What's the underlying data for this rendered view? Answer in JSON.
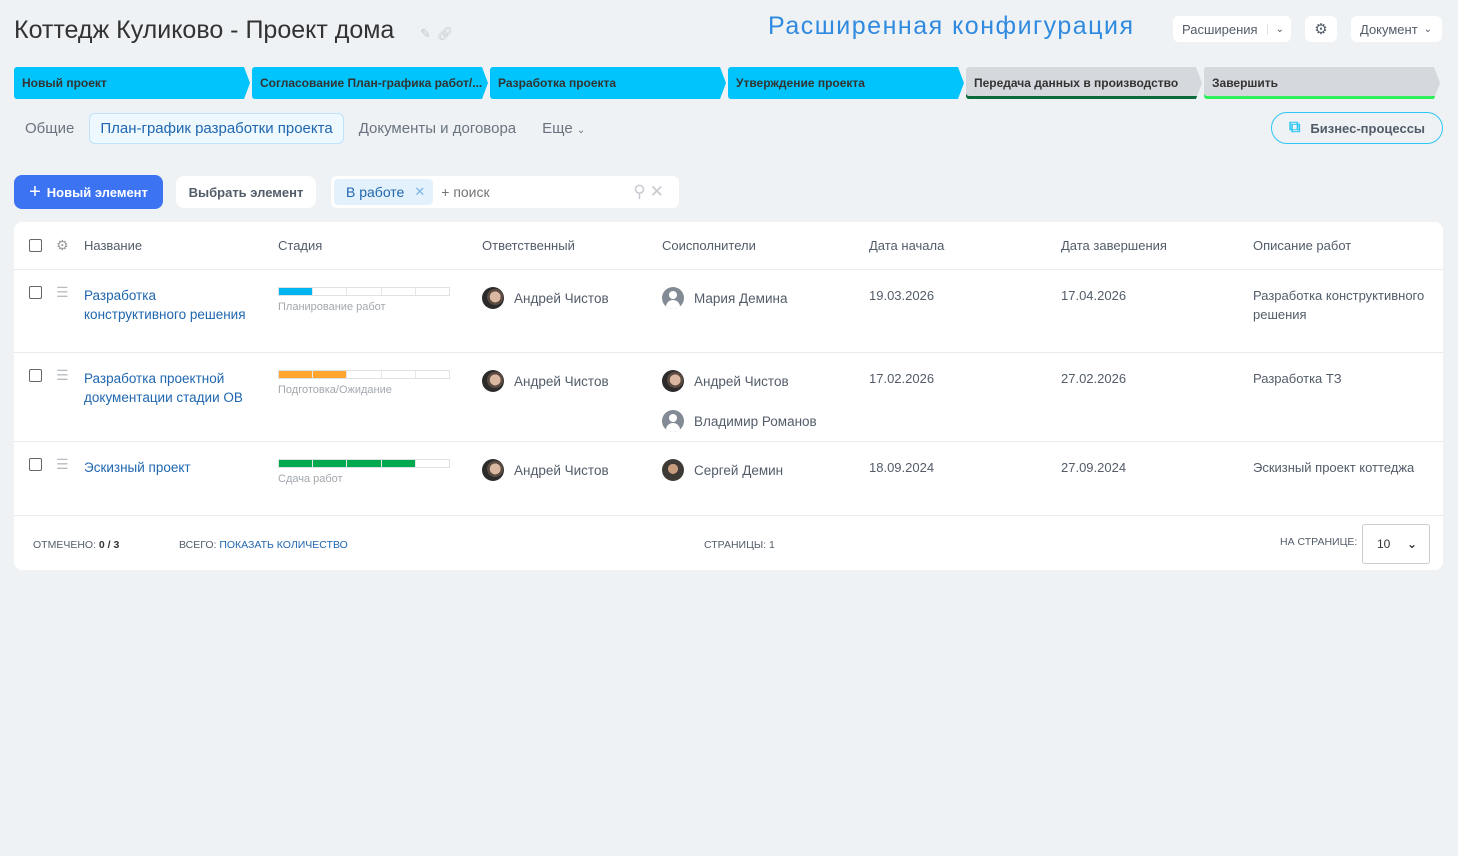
{
  "header": {
    "title": "Коттедж Куликово - Проект дома",
    "config_title": "Расширенная конфигурация",
    "extensions_label": "Расширения",
    "document_label": "Документ"
  },
  "stages": [
    {
      "label": "Новый проект",
      "state": "done"
    },
    {
      "label": "Согласование План-графика работ/...",
      "state": "done"
    },
    {
      "label": "Разработка проекта",
      "state": "done"
    },
    {
      "label": "Утверждение проекта",
      "state": "done"
    },
    {
      "label": "Передача данных в производство",
      "state": "todo",
      "underline": "#0b6b3a"
    },
    {
      "label": "Завершить",
      "state": "todo",
      "underline": "#2ef05a"
    }
  ],
  "tabs": [
    {
      "label": "Общие"
    },
    {
      "label": "План-график разработки проекта"
    },
    {
      "label": "Документы и договора"
    },
    {
      "label": "Еще"
    }
  ],
  "bp_label": "Бизнес-процессы",
  "toolbar": {
    "new_label": "Новый элемент",
    "select_label": "Выбрать элемент",
    "filter_chip": "В работе",
    "search_placeholder": "+ поиск"
  },
  "table": {
    "columns": [
      "Название",
      "Стадия",
      "Ответственный",
      "Соисполнители",
      "Дата начала",
      "Дата завершения",
      "Описание работ"
    ],
    "rows": [
      {
        "name": "Разработка конструктивного решения",
        "stage": "Планирование работ",
        "progress": 0.2,
        "color": "#00b4f0",
        "responsible": "Андрей Чистов",
        "co": [
          {
            "name": "Мария Демина",
            "avatar": "default"
          }
        ],
        "start": "19.03.2026",
        "end": "17.04.2026",
        "desc": "Разработка конструктивного решения"
      },
      {
        "name": "Разработка проектной документации стадии ОВ",
        "stage": "Подготовка/Ожидание",
        "progress": 0.4,
        "color": "#ffa530",
        "responsible": "Андрей Чистов",
        "co": [
          {
            "name": "Андрей Чистов",
            "avatar": "photo"
          },
          {
            "name": "Владимир Романов",
            "avatar": "default"
          }
        ],
        "start": "17.02.2026",
        "end": "27.02.2026",
        "desc": "Разработка ТЗ"
      },
      {
        "name": "Эскизный проект",
        "stage": "Сдача работ",
        "progress": 0.8,
        "color": "#00a94f",
        "responsible": "Андрей Чистов",
        "co": [
          {
            "name": "Сергей Демин",
            "avatar": "photo2"
          }
        ],
        "start": "18.09.2024",
        "end": "27.09.2024",
        "desc": "Эскизный проект коттеджа"
      }
    ]
  },
  "footer": {
    "checked_label": "ОТМЕЧЕНО:",
    "checked_value": "0 / 3",
    "total_label": "ВСЕГО:",
    "total_link": "ПОКАЗАТЬ КОЛИЧЕСТВО",
    "pages_label": "СТРАНИЦЫ:",
    "pages_value": "1",
    "per_page_label": "НА СТРАНИЦЕ:",
    "per_page_value": "10"
  }
}
